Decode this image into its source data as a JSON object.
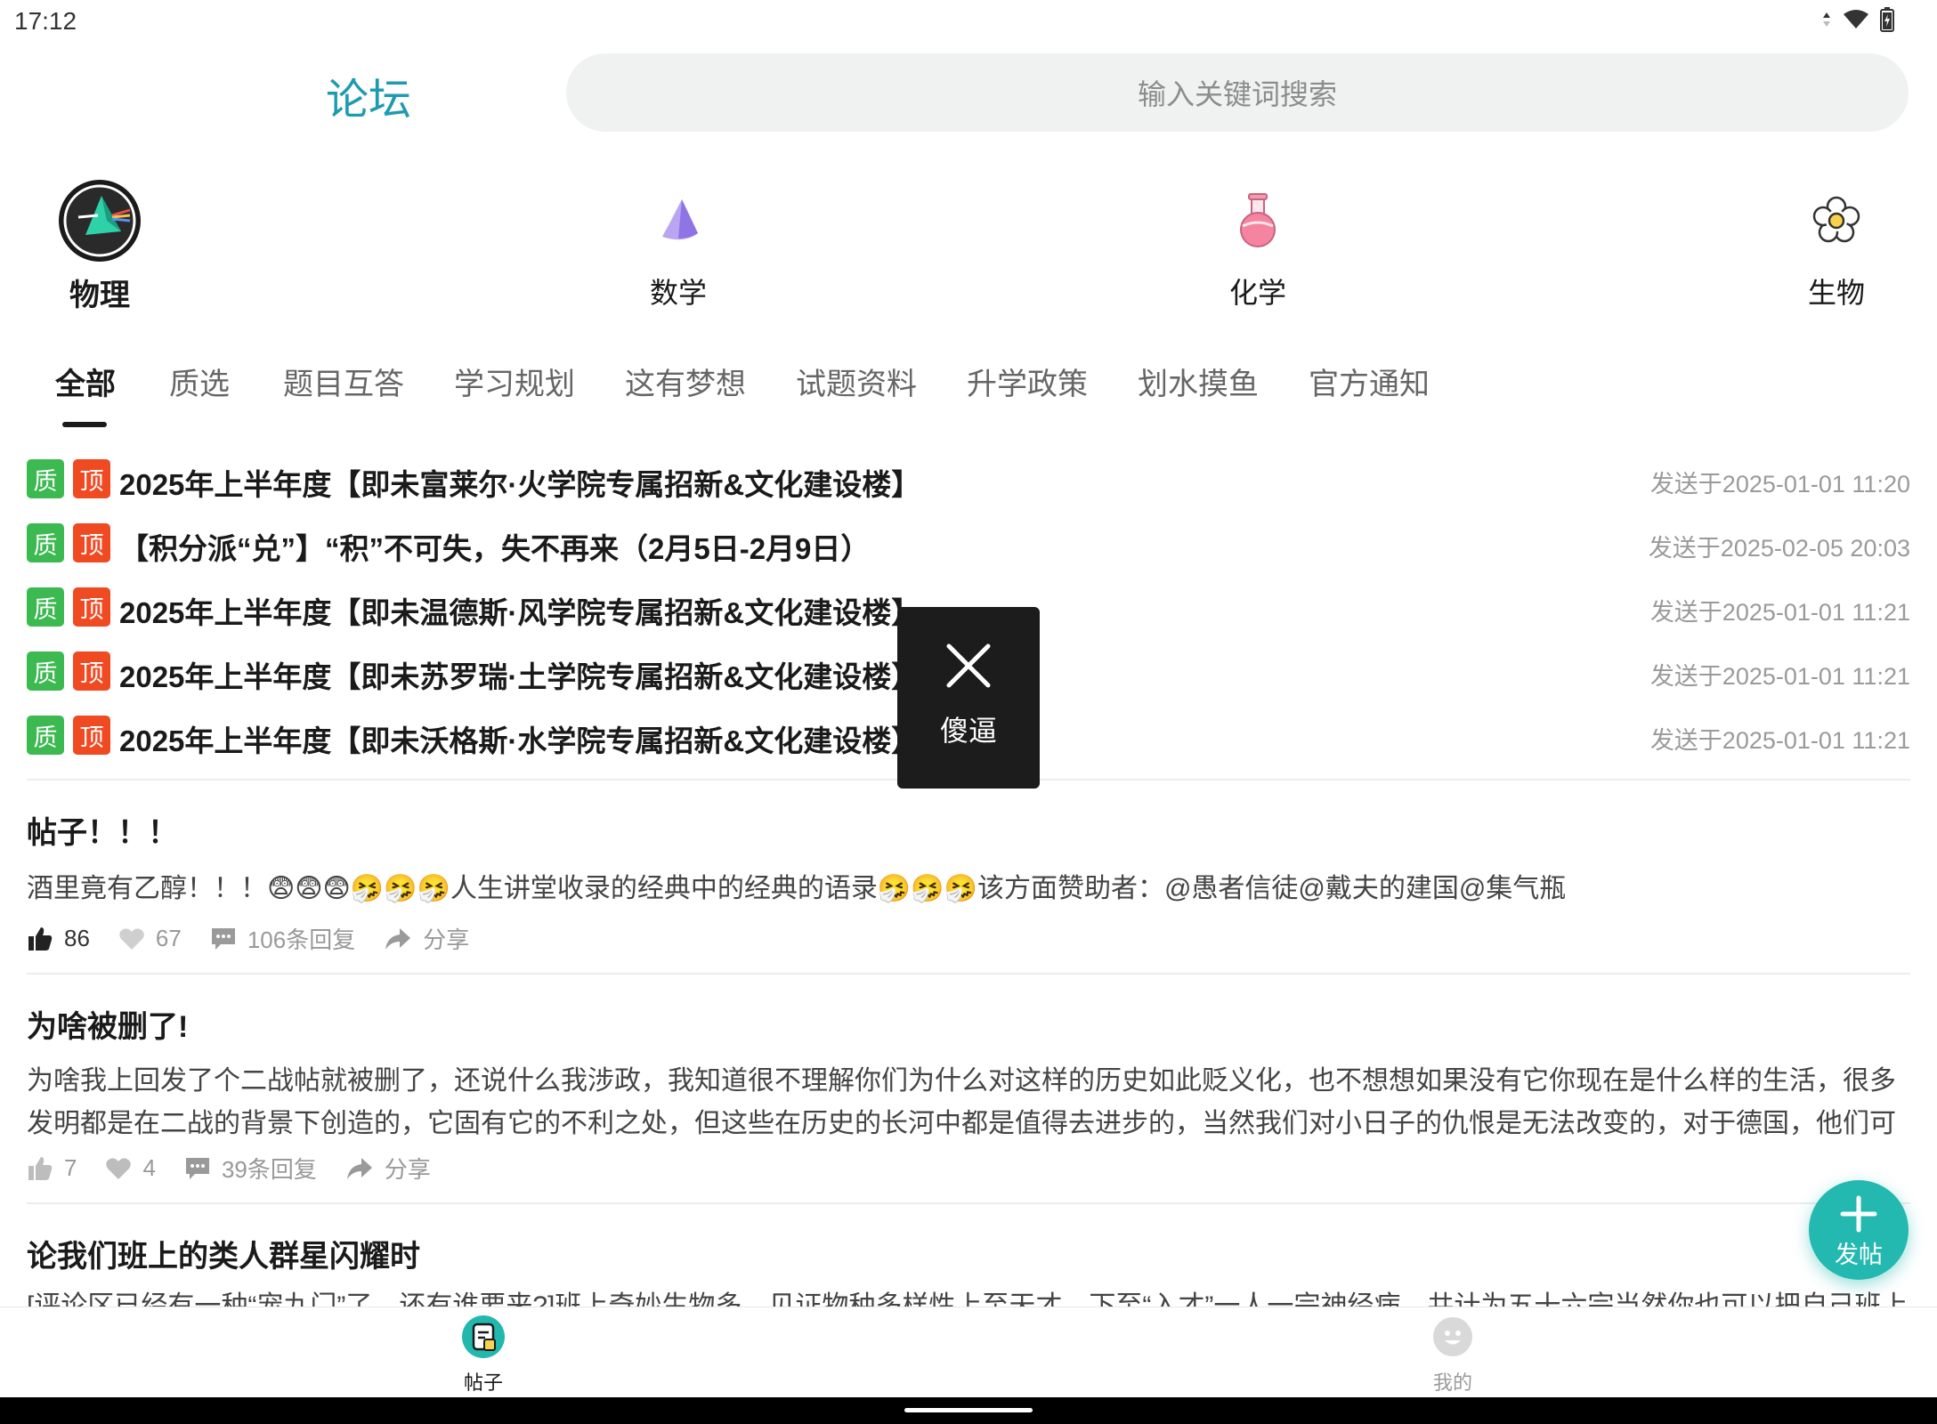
{
  "status_bar": {
    "time": "17:12"
  },
  "header": {
    "title": "论坛",
    "search_placeholder": "输入关键词搜索"
  },
  "subjects": [
    {
      "label": "物理",
      "active": true
    },
    {
      "label": "数学",
      "active": false
    },
    {
      "label": "化学",
      "active": false
    },
    {
      "label": "生物",
      "active": false
    }
  ],
  "tabs": [
    "全部",
    "质选",
    "题目互答",
    "学习规划",
    "这有梦想",
    "试题资料",
    "升学政策",
    "划水摸鱼",
    "官方通知"
  ],
  "tag_labels": {
    "quality": "质",
    "top": "顶"
  },
  "pinned": [
    {
      "title": "2025年上半年度【即未富莱尔·火学院专属招新&文化建设楼】",
      "time": "发送于2025-01-01 11:20"
    },
    {
      "title": "【积分派“兑”】“积”不可失，失不再来（2月5日-2月9日）",
      "time": "发送于2025-02-05 20:03"
    },
    {
      "title": "2025年上半年度【即未温德斯·风学院专属招新&文化建设楼】",
      "time": "发送于2025-01-01 11:21"
    },
    {
      "title": "2025年上半年度【即未苏罗瑞·土学院专属招新&文化建设楼】",
      "time": "发送于2025-01-01 11:21"
    },
    {
      "title": "2025年上半年度【即未沃格斯·水学院专属招新&文化建设楼】",
      "time": "发送于2025-01-01 11:21"
    }
  ],
  "posts": [
    {
      "title": "帖子！！！",
      "body": "酒里竟有乙醇！！！😨😨😨🤧🤧🤧人生讲堂收录的经典中的经典的语录🤧🤧🤧该方面赞助者：@愚者信徒@戴夫的建国@集气瓶",
      "likes": "86",
      "favorites": "67",
      "replies": "106条回复",
      "share": "分享"
    },
    {
      "title": "为啥被删了!",
      "body": "为啥我上回发了个二战帖就被删了，还说什么我涉政，我知道很不理解你们为什么对这样的历史如此贬义化，也不想想如果没有它你现在是什么样的生活，很多发明都是在二战的背景下创造的，它固有它的不利之处，但这些在历史的长河中都是值得去进步的，当然我们对小日子的仇恨是无法改变的，对于德国，他们可是在二战期间帮助过…",
      "likes": "7",
      "favorites": "4",
      "replies": "39条回复",
      "share": "分享"
    },
    {
      "title": "论我们班上的类人群星闪耀时",
      "body": "[评论区已经有一种“宠九门”了，还有谁要来?]班上奇妙生物多，见证物种多样性上至天才，下至“入才”一人一宗神经病，共计为五十六宗当然你也可以把自己班上的奇才发"
    }
  ],
  "toast": {
    "text": "傻逼"
  },
  "fab": {
    "label": "发帖"
  },
  "bottom_nav": [
    {
      "label": "帖子",
      "active": true
    },
    {
      "label": "我的",
      "active": false
    }
  ],
  "colors": {
    "accent": "#1e9bb0",
    "fab": "#23b9b0",
    "quality_tag": "#3cb950",
    "top_tag": "#f04a23"
  }
}
